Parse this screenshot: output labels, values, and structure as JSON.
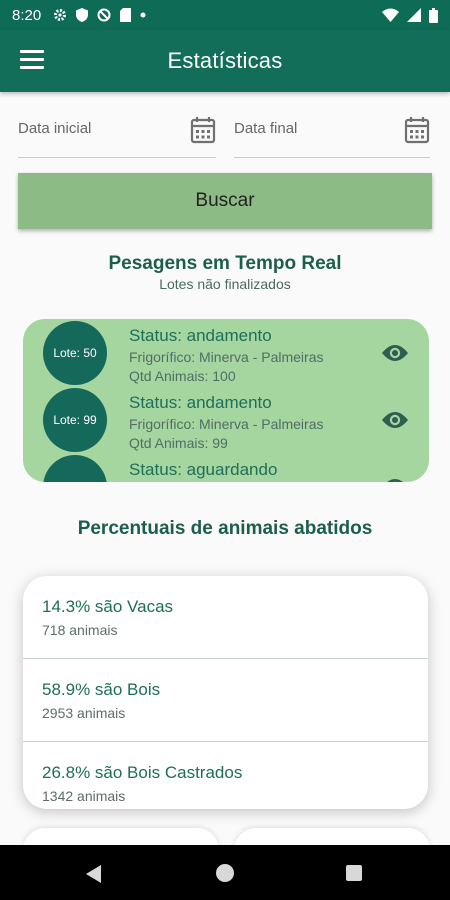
{
  "status_bar": {
    "time": "8:20"
  },
  "app_bar": {
    "title": "Estatísticas"
  },
  "filters": {
    "start_date_label": "Data inicial",
    "end_date_label": "Data final",
    "search_button": "Buscar"
  },
  "realtime": {
    "title": "Pesagens em Tempo Real",
    "subtitle": "Lotes não finalizados",
    "lots": [
      {
        "badge": "Lote: 50",
        "status": "Status: andamento",
        "frigorifico": "Frigorífico: Minerva - Palmeiras",
        "qtd": "Qtd Animais: 100"
      },
      {
        "badge": "Lote: 99",
        "status": "Status: andamento",
        "frigorifico": "Frigorífico: Minerva - Palmeiras",
        "qtd": "Qtd Animais: 99"
      },
      {
        "badge": "",
        "status": "Status: aguardando",
        "frigorifico": "",
        "qtd": ""
      }
    ]
  },
  "percentages": {
    "title": "Percentuais de animais abatidos",
    "items": [
      {
        "label": "14.3% são Vacas",
        "count": "718 animais"
      },
      {
        "label": "58.9% são Bois",
        "count": "2953 animais"
      },
      {
        "label": "26.8% são Bois Castrados",
        "count": "1342 animais"
      }
    ]
  },
  "colors": {
    "primary": "#126e59",
    "button": "#8dbb85",
    "lots_card": "#a6d6a0",
    "badge": "#15695a"
  }
}
